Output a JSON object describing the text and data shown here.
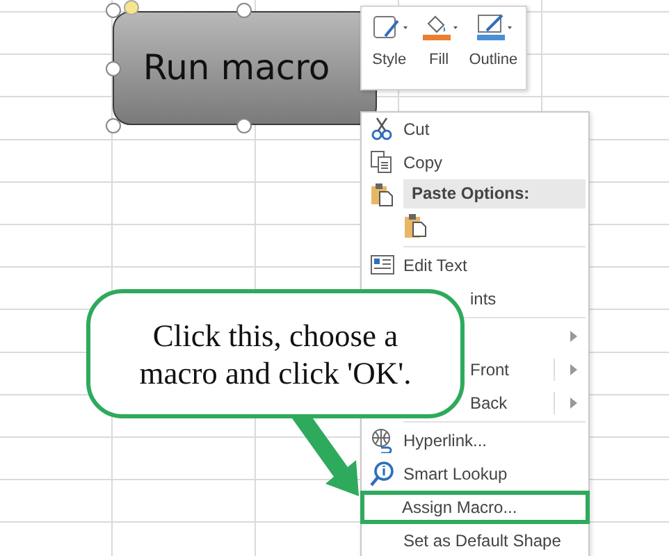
{
  "shape": {
    "label": "Run macro",
    "selected": true
  },
  "mini_toolbar": {
    "buttons": [
      {
        "label": "Style"
      },
      {
        "label": "Fill",
        "color": "#ed7d31"
      },
      {
        "label": "Outline",
        "color": "#4a90d9"
      }
    ]
  },
  "context_menu": {
    "items": [
      {
        "kind": "item",
        "label": "Cut",
        "outlined": false
      },
      {
        "kind": "item",
        "label": "Copy",
        "outlined": false
      },
      {
        "kind": "header",
        "label": "Paste Options:",
        "outlined": false
      },
      {
        "kind": "paste-option"
      },
      {
        "kind": "separator"
      },
      {
        "kind": "item",
        "label": "Edit Text",
        "outlined": false
      },
      {
        "kind": "partial",
        "label": "ints"
      },
      {
        "kind": "separator"
      },
      {
        "kind": "partial",
        "submenu": true
      },
      {
        "kind": "partial",
        "label": "Front",
        "submenu": true
      },
      {
        "kind": "partial",
        "label": "Back",
        "submenu": true
      },
      {
        "kind": "separator"
      },
      {
        "kind": "item",
        "label": "Hyperlink...",
        "outlined": false
      },
      {
        "kind": "item",
        "label": "Smart Lookup",
        "outlined": false
      },
      {
        "kind": "item",
        "label": "Assign Macro...",
        "outlined": true
      },
      {
        "kind": "item",
        "label": "Set as Default Shape",
        "outlined": false
      }
    ]
  },
  "callout": {
    "text": "Click this, choose a macro and click 'OK'."
  }
}
